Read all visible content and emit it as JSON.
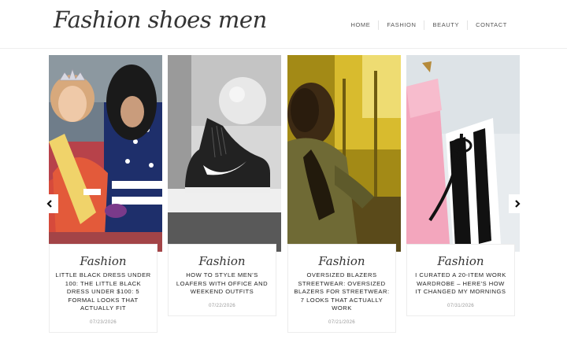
{
  "site": {
    "logo": "Fashion shoes men"
  },
  "nav": {
    "items": [
      "HOME",
      "FASHION",
      "BEAUTY",
      "CONTACT"
    ]
  },
  "posts": [
    {
      "category": "Fashion",
      "title": "LITTLE BLACK DRESS UNDER 100: THE LITTLE BLACK DRESS UNDER $100: 5 FORMAL LOOKS THAT ACTUALLY FIT",
      "date": "07/23/2026"
    },
    {
      "category": "Fashion",
      "title": "HOW TO STYLE MEN'S LOAFERS WITH OFFICE AND WEEKEND OUTFITS",
      "date": "07/22/2026"
    },
    {
      "category": "Fashion",
      "title": "OVERSIZED BLAZERS STREETWEAR: OVERSIZED BLAZERS FOR STREETWEAR: 7 LOOKS THAT ACTUALLY WORK",
      "date": "07/21/2026"
    },
    {
      "category": "Fashion",
      "title": "I CURATED A 20-ITEM WORK WARDROBE – HERE'S HOW IT CHANGED MY MORNINGS",
      "date": "07/31/2026"
    }
  ],
  "carousel": {
    "prev_icon": "chevron-left-icon",
    "next_icon": "chevron-right-icon"
  }
}
